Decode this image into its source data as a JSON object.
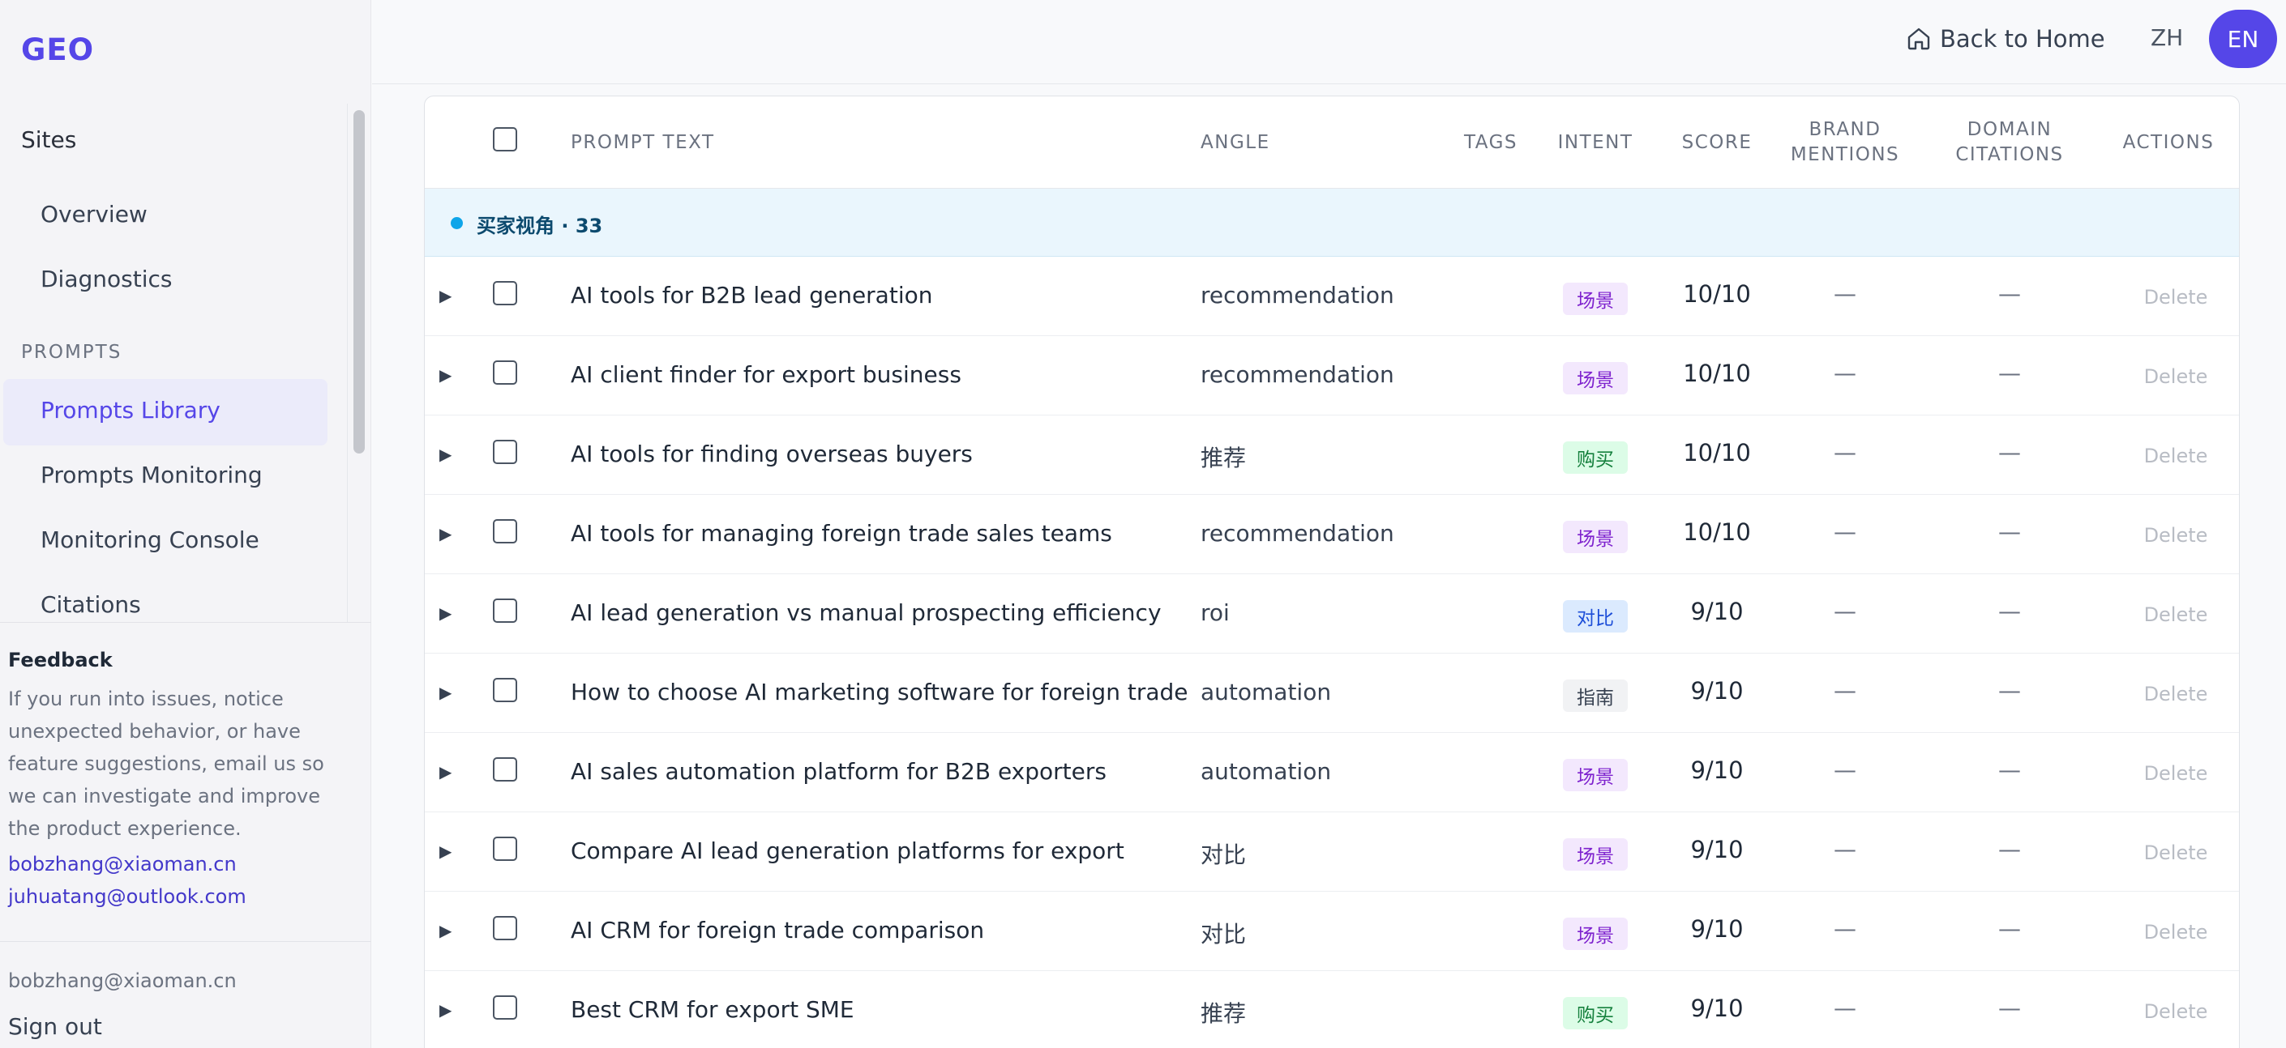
{
  "app": {
    "logo": "GEO"
  },
  "sidebar": {
    "group_sites": "Sites",
    "items_sites": [
      "Overview",
      "Diagnostics"
    ],
    "section_prompts": "PROMPTS",
    "active_item": "Prompts Library",
    "items_prompts": [
      "Prompts Monitoring",
      "Monitoring Console",
      "Citations"
    ]
  },
  "feedback": {
    "title": "Feedback",
    "text": "If you run into issues, notice unexpected behavior, or have feature suggestions, email us so we can investigate and improve the product experience.",
    "email1": "bobzhang@xiaoman.cn",
    "email2": "juhuatang@outlook.com"
  },
  "account": {
    "email": "bobzhang@xiaoman.cn",
    "sign_out": "Sign out"
  },
  "header": {
    "back_home": "Back to Home",
    "lang_zh": "ZH",
    "lang_en": "EN"
  },
  "table": {
    "columns": {
      "prompt_text": "PROMPT TEXT",
      "angle": "ANGLE",
      "tags": "TAGS",
      "intent": "INTENT",
      "score": "SCORE",
      "brand_1": "BRAND",
      "brand_2": "MENTIONS",
      "domain_1": "DOMAIN",
      "domain_2": "CITATIONS",
      "actions": "ACTIONS"
    },
    "group_label": "买家视角 · 33",
    "rows": [
      {
        "text": "AI tools for B2B lead generation",
        "angle": "recommendation",
        "intent": "场景",
        "intent_color": "purple",
        "score": "10/10",
        "brand": "—",
        "domain": "—",
        "action": "Delete"
      },
      {
        "text": "AI client finder for export business",
        "angle": "recommendation",
        "intent": "场景",
        "intent_color": "purple",
        "score": "10/10",
        "brand": "—",
        "domain": "—",
        "action": "Delete"
      },
      {
        "text": "AI tools for finding overseas buyers",
        "angle": "推荐",
        "intent": "购买",
        "intent_color": "green",
        "score": "10/10",
        "brand": "—",
        "domain": "—",
        "action": "Delete"
      },
      {
        "text": "AI tools for managing foreign trade sales teams",
        "angle": "recommendation",
        "intent": "场景",
        "intent_color": "purple",
        "score": "10/10",
        "brand": "—",
        "domain": "—",
        "action": "Delete"
      },
      {
        "text": "AI lead generation vs manual prospecting efficiency",
        "angle": "roi",
        "intent": "对比",
        "intent_color": "blue",
        "score": "9/10",
        "brand": "—",
        "domain": "—",
        "action": "Delete"
      },
      {
        "text": "How to choose AI marketing software for foreign trade",
        "angle": "automation",
        "intent": "指南",
        "intent_color": "gray",
        "score": "9/10",
        "brand": "—",
        "domain": "—",
        "action": "Delete"
      },
      {
        "text": "AI sales automation platform for B2B exporters",
        "angle": "automation",
        "intent": "场景",
        "intent_color": "purple",
        "score": "9/10",
        "brand": "—",
        "domain": "—",
        "action": "Delete"
      },
      {
        "text": "Compare AI lead generation platforms for export",
        "angle": "对比",
        "intent": "场景",
        "intent_color": "purple",
        "score": "9/10",
        "brand": "—",
        "domain": "—",
        "action": "Delete"
      },
      {
        "text": "AI CRM for foreign trade comparison",
        "angle": "对比",
        "intent": "场景",
        "intent_color": "purple",
        "score": "9/10",
        "brand": "—",
        "domain": "—",
        "action": "Delete"
      },
      {
        "text": "Best CRM for export SME",
        "angle": "推荐",
        "intent": "购买",
        "intent_color": "green",
        "score": "9/10",
        "brand": "—",
        "domain": "—",
        "action": "Delete"
      }
    ]
  }
}
